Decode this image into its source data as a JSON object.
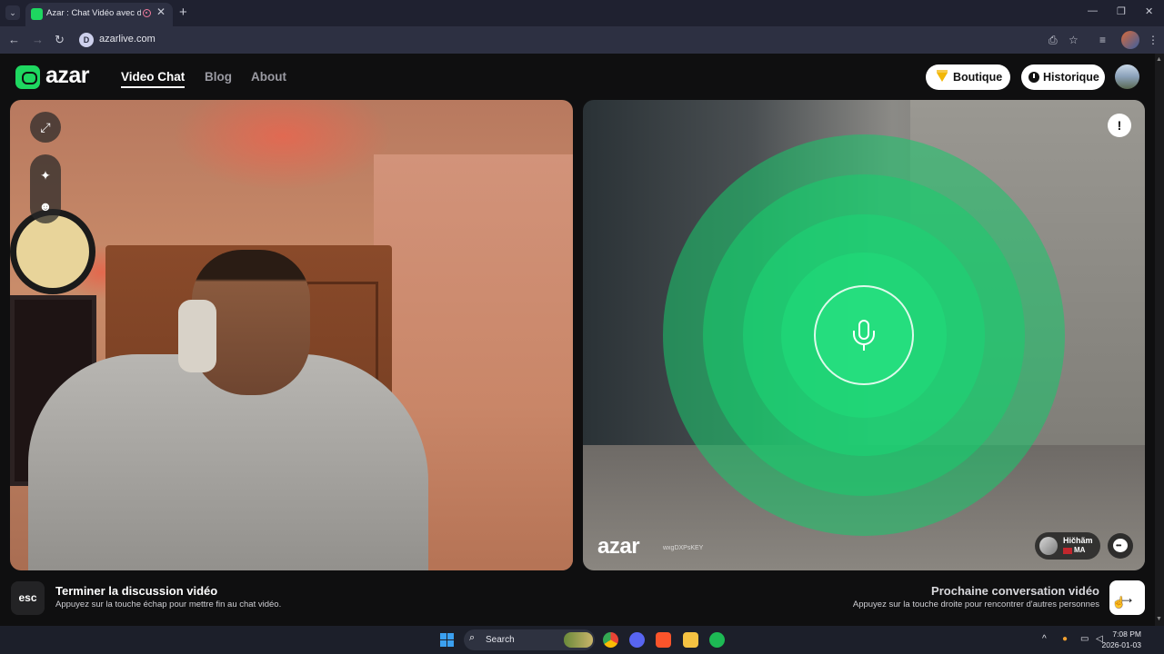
{
  "browser": {
    "tab_title": "Azar : Chat Vidéo avec de n",
    "url": "azarlive.com",
    "new_tab_icon": "plus-icon",
    "window_controls": [
      "minimize-icon",
      "restore-icon",
      "close-icon"
    ]
  },
  "header": {
    "logo_text": "azar",
    "nav": [
      "Video Chat",
      "Blog",
      "About"
    ],
    "active_nav": "Video Chat",
    "boutique_label": "Boutique",
    "historique_label": "Historique"
  },
  "local_video": {
    "controls": [
      "expand-icon",
      "sparkle-effects-icon",
      "face-filter-icon"
    ]
  },
  "remote_video": {
    "watermark_logo": "azar",
    "watermark_id": "wxgDXPsKEY",
    "peer_name": "Hičhãm",
    "peer_country": "MA",
    "accent_color": "#1ed760"
  },
  "footer": {
    "esc_label": "esc",
    "end_title": "Terminer la discussion vidéo",
    "end_subtitle": "Appuyez sur la touche échap pour mettre fin au chat vidéo.",
    "next_title": "Prochaine conversation vidéo",
    "next_subtitle": "Appuyez sur la touche droite pour rencontrer d'autres personnes",
    "next_icon": "arrow-right-icon"
  },
  "taskbar": {
    "search_label": "Search",
    "time": "7:08 PM",
    "date": "2026-01-03",
    "apps": [
      "chrome",
      "discord",
      "brave",
      "file-explorer",
      "spotify"
    ]
  }
}
